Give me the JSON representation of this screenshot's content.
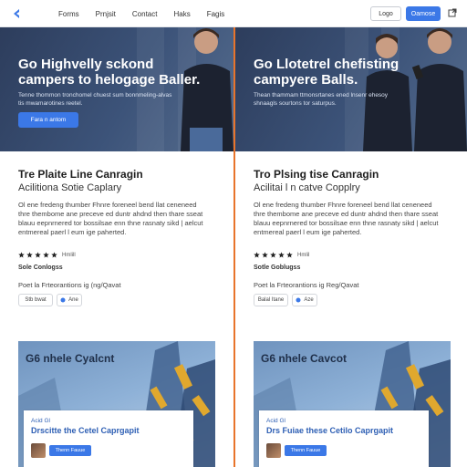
{
  "nav": {
    "links": [
      "Forms",
      "Prnjsit",
      "Contact",
      "Haks",
      "Fagis"
    ],
    "login_label": "Logo",
    "cta_label": "Oamose",
    "logo_icon": "brand-logo-icon",
    "ext_icon": "external-link-icon",
    "accent": "#3b78e7"
  },
  "left": {
    "hero": {
      "title": "Go Highvelly sckond campers to helogage Baller.",
      "subtitle": "Tenne thommon tronchomel chuest sum bonnmeling-alvas tis mwamarotines reetel.",
      "button": "Fara n antom"
    },
    "content": {
      "title": "Tre Plaite Line Canragin",
      "subtitle": "Acilitiona Sotie Caplary",
      "body": "Ol ene fredeng thumber Fhnre foreneel bend llat ceneneed thre thembome ane preceve ed duntr ahdnd then thare sseat blauu eepnrnered tor bossilsae enn thne rasnaty sikd | aelcut entmereal paerl l eum ige paherted.",
      "rating": "Hmlill",
      "tag": "Sole Conlogss",
      "posted": "Poet la Frteorantions ig (ng/Qavat",
      "chip1": "Stb bwat",
      "chip2": "Ane"
    },
    "card": {
      "title": "G6 nhele Cyalcnt",
      "label": "Acid Gl",
      "panel_title": "Drscitte the Cetel Caprgapit",
      "button": "Thenn Fauue"
    }
  },
  "right": {
    "hero": {
      "title": "Go Llotetrel chefisting campyere Balls.",
      "subtitle": "Thean thammam ttmonsrtanes ened lnsenr ehesoy shnaagls sourtons tor saturpus.",
      "button": ""
    },
    "content": {
      "title": "Tro Plsing tise Canragin",
      "subtitle": "Acilitai l n catve Copplry",
      "body": "Ol ene fredeng thumber Fhnre foreneel bend llat ceneneed thre thembome ane preceve ed duntr ahdnd then thare sseat blauu eepnrnered tor bossilsae enn thne rasnaty sikd | aelcut entmereal paerl l eum ige paherted.",
      "rating": "Hmlil",
      "tag": "Sotle Goblugss",
      "posted": "Poet la Frteorantions ig Reg/Qavat",
      "chip1": "Balal Itane",
      "chip2": "Aze"
    },
    "card": {
      "title": "G6 nhele Cavcot",
      "label": "Acid Gl",
      "panel_title": "Drs Fuiae these Cetilo Caprgapit",
      "button": "Thenn Fauue"
    }
  },
  "colors": {
    "accent": "#3b78e7",
    "divider": "#e8742b",
    "hero_bg": "#34466a",
    "star": "#222222"
  },
  "ratings": {
    "left_stars": 5,
    "right_stars": 5
  }
}
